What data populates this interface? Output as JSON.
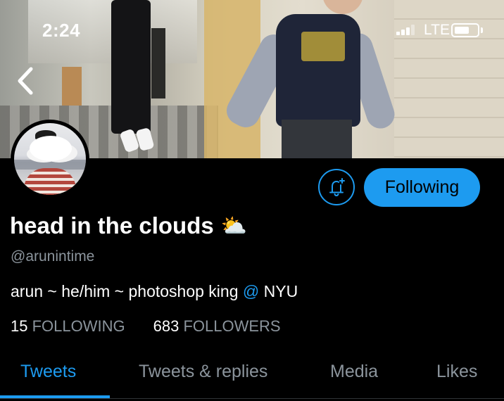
{
  "status_bar": {
    "time": "2:24",
    "network": "LTE"
  },
  "banner": {
    "icon": "hallway-photo"
  },
  "navigation": {
    "back_icon": "chevron-left-icon"
  },
  "profile": {
    "display_name": "head in the clouds",
    "name_emoji": "⛅",
    "handle": "@arunintime",
    "bio_prefix": "arun ~ he/him ~ photoshop king ",
    "bio_mention": "@",
    "bio_suffix": " NYU",
    "following_count": "15",
    "following_label": "FOLLOWING",
    "followers_count": "683",
    "followers_label": "FOLLOWERS"
  },
  "actions": {
    "notify_icon": "bell-plus-icon",
    "follow_label": "Following"
  },
  "tabs": [
    {
      "label": "Tweets",
      "active": true
    },
    {
      "label": "Tweets & replies",
      "active": false
    },
    {
      "label": "Media",
      "active": false
    },
    {
      "label": "Likes",
      "active": false
    }
  ],
  "colors": {
    "accent": "#1d9bf0",
    "background": "#000000",
    "secondary_text": "#8b949c"
  }
}
